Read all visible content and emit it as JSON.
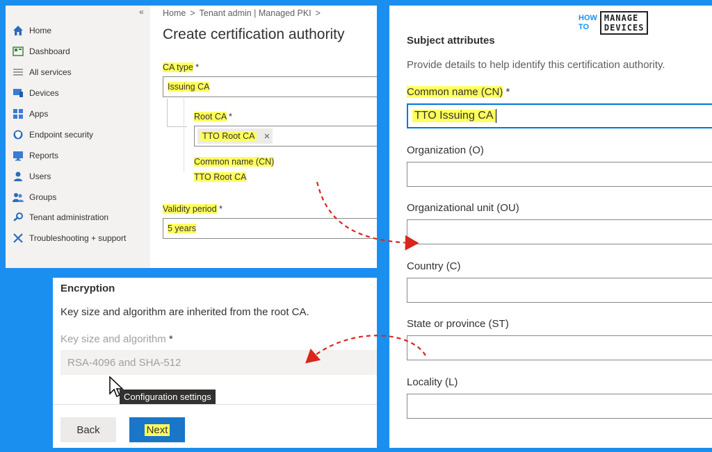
{
  "sidebar": {
    "items": [
      {
        "label": "Home",
        "icon": "home-icon"
      },
      {
        "label": "Dashboard",
        "icon": "dashboard-icon"
      },
      {
        "label": "All services",
        "icon": "list-icon"
      },
      {
        "label": "Devices",
        "icon": "devices-icon"
      },
      {
        "label": "Apps",
        "icon": "apps-icon"
      },
      {
        "label": "Endpoint security",
        "icon": "shield-icon"
      },
      {
        "label": "Reports",
        "icon": "reports-icon"
      },
      {
        "label": "Users",
        "icon": "user-icon"
      },
      {
        "label": "Groups",
        "icon": "groups-icon"
      },
      {
        "label": "Tenant administration",
        "icon": "wrench-icon"
      },
      {
        "label": "Troubleshooting + support",
        "icon": "tools-icon"
      }
    ],
    "collapse": "«"
  },
  "breadcrumb": {
    "home": "Home",
    "tenant": "Tenant admin | Managed PKI",
    "sep": ">"
  },
  "page_title": "Create certification authority",
  "ca_type": {
    "label": "CA type",
    "required": "*",
    "value": "Issuing CA"
  },
  "root_ca": {
    "label": "Root CA",
    "required": "*",
    "value": "TTO Root CA",
    "remove": "×"
  },
  "root_cn": {
    "label": "Common name (CN)",
    "value": "TTO Root CA"
  },
  "validity": {
    "label": "Validity period",
    "required": "*",
    "value": "5 years"
  },
  "encryption": {
    "heading": "Encryption",
    "desc": "Key size and algorithm are inherited from the root CA.",
    "key_label": "Key size and algorithm",
    "required": "*",
    "key_value": "RSA-4096 and SHA-512",
    "tooltip": "Configuration settings"
  },
  "buttons": {
    "back": "Back",
    "next": "Next"
  },
  "subject": {
    "heading": "Subject attributes",
    "desc": "Provide details to help identify this certification authority.",
    "cn_label": "Common name (CN)",
    "cn_required": "*",
    "cn_value": "TTO Issuing CA",
    "org_label": "Organization (O)",
    "ou_label": "Organizational unit (OU)",
    "country_label": "Country (C)",
    "state_label": "State or province (ST)",
    "locality_label": "Locality (L)"
  },
  "logo": {
    "how": "HOW",
    "to": "TO",
    "manage": "MANAGE",
    "devices": "DEVICES"
  },
  "colors": {
    "background": "#1a8ff0",
    "highlight": "#ffff5c",
    "next_button": "#1976c9",
    "arrow": "#d9261c"
  }
}
